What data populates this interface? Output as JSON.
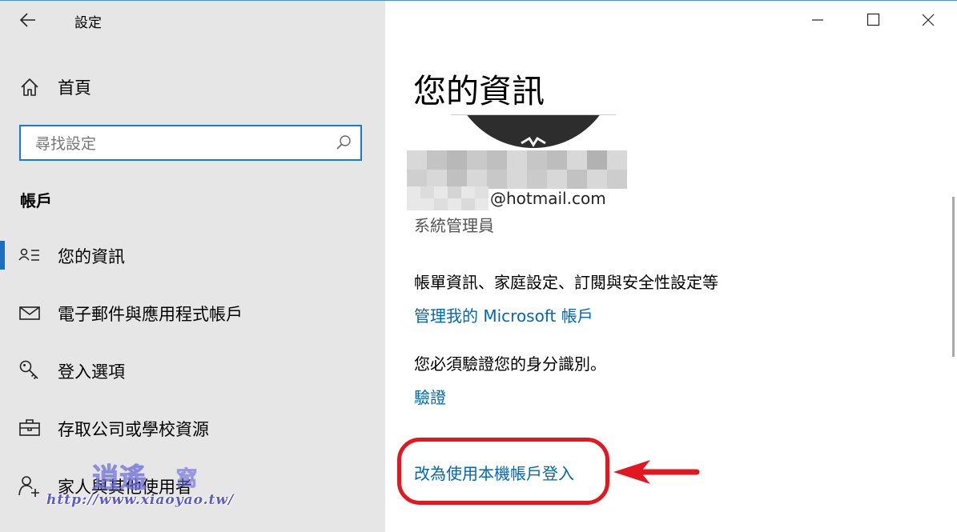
{
  "window": {
    "title": "設定",
    "controls": [
      "minimize-icon",
      "maximize-icon",
      "close-icon"
    ]
  },
  "sidebar": {
    "home_label": "首頁",
    "search_placeholder": "尋找設定",
    "section_title": "帳戶",
    "items": [
      {
        "label": "您的資訊",
        "icon": "person-list-icon",
        "active": true
      },
      {
        "label": "電子郵件與應用程式帳戶",
        "icon": "mail-icon",
        "active": false
      },
      {
        "label": "登入選項",
        "icon": "key-icon",
        "active": false
      },
      {
        "label": "存取公司或學校資源",
        "icon": "briefcase-icon",
        "active": false
      },
      {
        "label": "家人與其他使用者",
        "icon": "person-add-icon",
        "active": false
      }
    ]
  },
  "main": {
    "title": "您的資訊",
    "email_suffix": "@hotmail.com",
    "role": "系統管理員",
    "account_info_text": "帳單資訊、家庭設定、訂閱與安全性設定等",
    "manage_link": "管理我的 Microsoft 帳戶",
    "verify_text": "您必須驗證您的身分識別。",
    "verify_link": "驗證",
    "local_account_link": "改為使用本機帳戶登入"
  },
  "watermark": {
    "url": "http://www.xiaoyao.tw/"
  },
  "colors": {
    "accent": "#0067b8",
    "highlight": "#e3171f",
    "sidebar_bg": "#e6e6e6"
  }
}
